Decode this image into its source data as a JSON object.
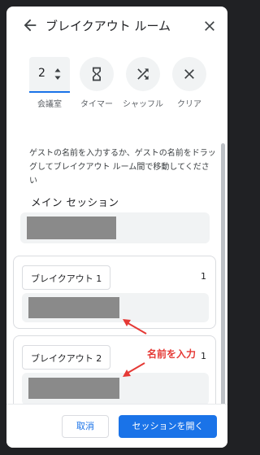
{
  "header": {
    "title": "ブレイクアウト ルーム"
  },
  "tools": {
    "room_count": "2",
    "room_count_label": "会議室",
    "timer_label": "タイマー",
    "shuffle_label": "シャッフル",
    "clear_label": "クリア"
  },
  "help_text": "ゲストの名前を入力するか、ゲストの名前をドラッグしてブレイクアウト ルーム間で移動してください",
  "main_session": {
    "label": "メイン セッション"
  },
  "rooms": [
    {
      "name": "ブレイクアウト 1",
      "count": "1"
    },
    {
      "name": "ブレイクアウト 2",
      "count": "1"
    }
  ],
  "annotation": "名前を入力",
  "footer": {
    "cancel_label": "取消",
    "open_label": "セッションを開く"
  },
  "colors": {
    "accent": "#1a73e8",
    "annotation": "#e53935",
    "redacted": "#8a8a8a"
  }
}
